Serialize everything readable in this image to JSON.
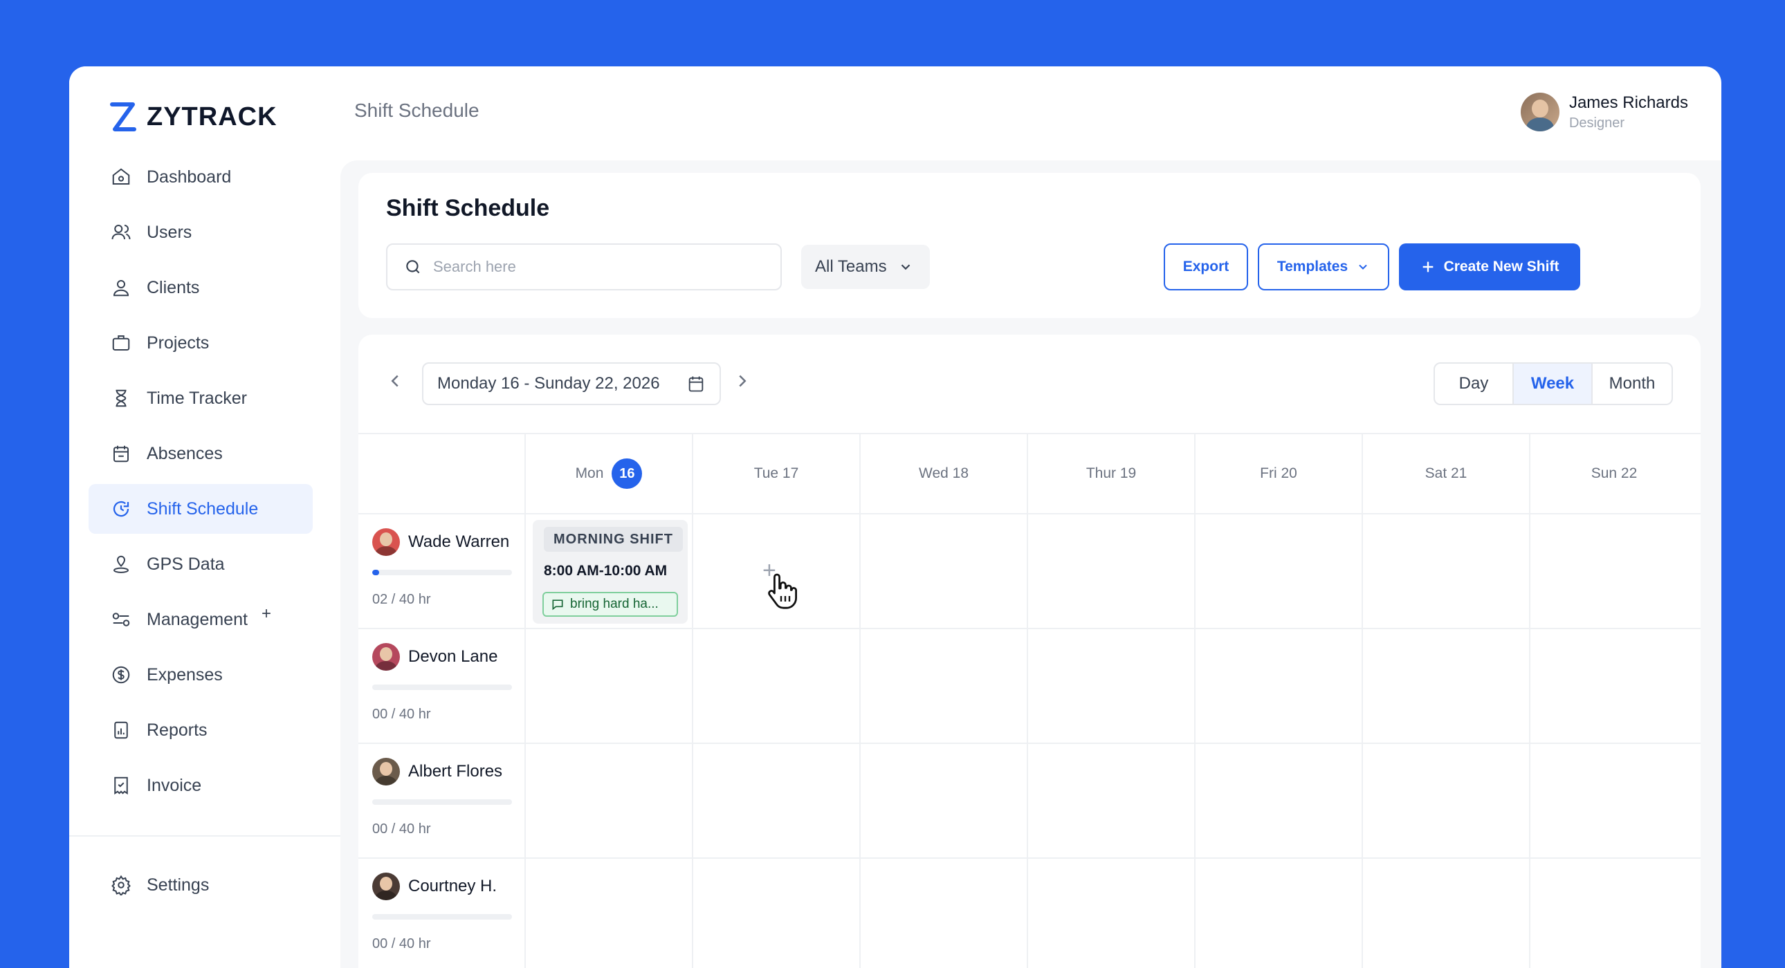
{
  "brand": {
    "name": "ZYTRACK",
    "color": "#2563eb"
  },
  "sidebar": {
    "items": [
      {
        "label": "Dashboard",
        "icon": "home-icon"
      },
      {
        "label": "Users",
        "icon": "users-icon"
      },
      {
        "label": "Clients",
        "icon": "user-icon"
      },
      {
        "label": "Projects",
        "icon": "briefcase-icon"
      },
      {
        "label": "Time Tracker",
        "icon": "hourglass-icon"
      },
      {
        "label": "Absences",
        "icon": "calendar-icon"
      },
      {
        "label": "Shift Schedule",
        "icon": "refresh-clock-icon",
        "active": true
      },
      {
        "label": "GPS Data",
        "icon": "location-icon"
      },
      {
        "label": "Management",
        "icon": "toggle-icon",
        "badge": "+"
      },
      {
        "label": "Expenses",
        "icon": "dollar-icon"
      },
      {
        "label": "Reports",
        "icon": "report-icon"
      },
      {
        "label": "Invoice",
        "icon": "invoice-icon"
      }
    ],
    "settings_label": "Settings"
  },
  "topbar": {
    "title": "Shift Schedule",
    "user": {
      "name": "James Richards",
      "role": "Designer"
    }
  },
  "header": {
    "title": "Shift Schedule",
    "search_placeholder": "Search here",
    "teams_filter": "All Teams",
    "export_label": "Export",
    "templates_label": "Templates",
    "create_label": "Create New Shift"
  },
  "calendar": {
    "date_range": "Monday 16 - Sunday 22, 2026",
    "views": [
      "Day",
      "Week",
      "Month"
    ],
    "active_view": "Week",
    "days": [
      {
        "label": "Mon",
        "badge": "16"
      },
      {
        "label": "Tue 17"
      },
      {
        "label": "Wed 18"
      },
      {
        "label": "Thur 19"
      },
      {
        "label": "Fri 20"
      },
      {
        "label": "Sat 21"
      },
      {
        "label": "Sun 22"
      }
    ],
    "employees": [
      {
        "name": "Wade Warren",
        "hours": "02 / 40 hr",
        "progress": 0.05,
        "avatar_color": "#d9534f"
      },
      {
        "name": "Devon Lane",
        "hours": "00 / 40 hr",
        "progress": 0,
        "avatar_color": "#b5485d"
      },
      {
        "name": "Albert Flores",
        "hours": "00 / 40 hr",
        "progress": 0,
        "avatar_color": "#6b5b4b"
      },
      {
        "name": "Courtney H.",
        "hours": "00 / 40 hr",
        "progress": 0,
        "avatar_color": "#4b3b35"
      }
    ],
    "shift": {
      "tag": "MORNING SHIFT",
      "time": "8:00 AM-10:00 AM",
      "note": "bring hard ha..."
    }
  }
}
